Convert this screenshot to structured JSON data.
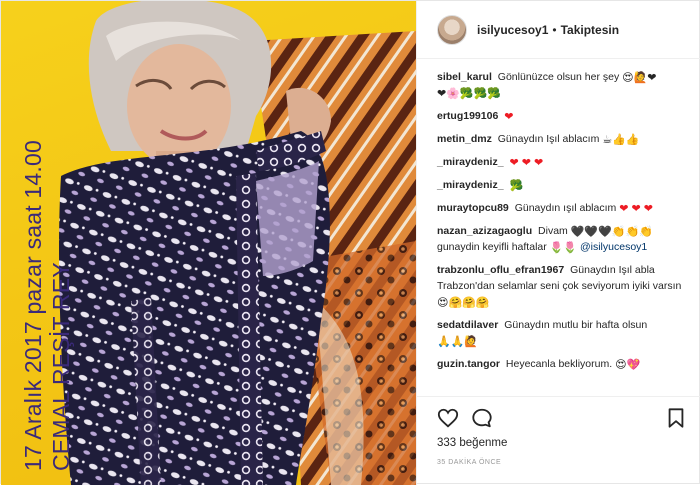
{
  "post_image": {
    "caption_lines": [
      "17 Aralık 2017 pazar saat 14.00",
      "CEMAL REŞİT REY"
    ],
    "background_color": "#f4c816",
    "caption_color": "#3b2a7a"
  },
  "header": {
    "username": "isilyucesoy1",
    "separator": "•",
    "follow_status": "Takiptesin"
  },
  "comments": [
    {
      "user": "sibel_karul",
      "text": "Gönlünüzce olsun her şey",
      "emoji": "😍🙋❤",
      "emoji_line2": "❤🌸🥦🥦🥦"
    },
    {
      "user": "ertug199106",
      "text": "",
      "emoji": "❤"
    },
    {
      "user": "metin_dmz",
      "text": "Günaydın Işıl ablacım",
      "emoji": "☕👍👍"
    },
    {
      "user": "_miraydeniz_",
      "text": "",
      "emoji": "❤ ❤ ❤"
    },
    {
      "user": "_miraydeniz_",
      "text": "",
      "emoji": "🥦"
    },
    {
      "user": "muraytopcu89",
      "text": "Günaydın ışıl ablacım",
      "emoji": "❤ ❤ ❤"
    },
    {
      "user": "nazan_azizagaoglu",
      "text": "Divam",
      "emoji": "🖤🖤🖤👏👏👏"
    },
    {
      "user": "",
      "text": "gunaydin keyifli haftalar",
      "emoji": "🌷🌷",
      "mention": "@isilyucesoy1"
    },
    {
      "user": "trabzonlu_oflu_efran1967",
      "text": "Günaydın Işıl abla Trabzon'dan selamlar seni çok seviyorum iyiki varsın",
      "emoji": "😍🤗🤗🤗"
    },
    {
      "user": "sedatdilaver",
      "text": "Günaydın mutlu bir hafta olsun",
      "emoji": "🙏🙏🙋"
    },
    {
      "user": "guzin.tangor",
      "text": "Heyecanla bekliyorum.",
      "emoji": "😍💖"
    }
  ],
  "actions": {
    "like_icon": "heart-outline-icon",
    "comment_icon": "speech-bubble-icon",
    "save_icon": "bookmark-icon"
  },
  "likes_text": "333 beğenme",
  "timestamp": "35 DAKİKA ÖNCE"
}
